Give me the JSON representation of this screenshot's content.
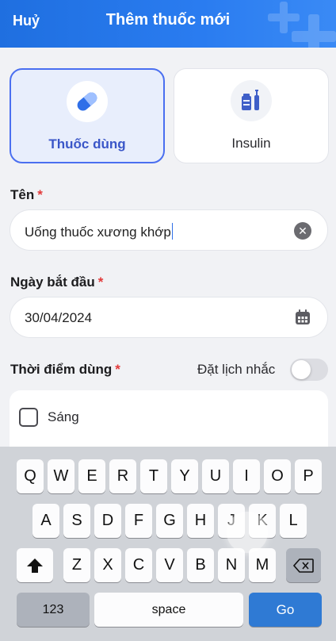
{
  "header": {
    "cancel_label": "Huỷ",
    "title": "Thêm thuốc mới"
  },
  "types": [
    {
      "label": "Thuốc dùng",
      "icon": "pill-icon",
      "selected": true
    },
    {
      "label": "Insulin",
      "icon": "insulin-vial-icon",
      "selected": false
    }
  ],
  "form": {
    "name": {
      "label": "Tên",
      "required_mark": "*",
      "value": "Uống thuốc xương khớp"
    },
    "start_date": {
      "label": "Ngày bắt đầu",
      "required_mark": "*",
      "value": "30/04/2024"
    },
    "time_of_use": {
      "label": "Thời điểm dùng",
      "required_mark": "*",
      "reminder_label": "Đặt lịch nhắc",
      "reminder_on": false
    },
    "times": [
      {
        "label": "Sáng",
        "checked": false
      }
    ]
  },
  "keyboard": {
    "row1": [
      "Q",
      "W",
      "E",
      "R",
      "T",
      "Y",
      "U",
      "I",
      "O",
      "P"
    ],
    "row2": [
      "A",
      "S",
      "D",
      "F",
      "G",
      "H",
      "J",
      "K",
      "L"
    ],
    "row3": [
      "Z",
      "X",
      "C",
      "V",
      "B",
      "N",
      "M"
    ],
    "numbers_label": "123",
    "space_label": "space",
    "go_label": "Go"
  },
  "colors": {
    "header": "#1f6fe0",
    "accent": "#4a6ff0",
    "required": "#e23a3a",
    "go_key": "#2f7ad4"
  }
}
